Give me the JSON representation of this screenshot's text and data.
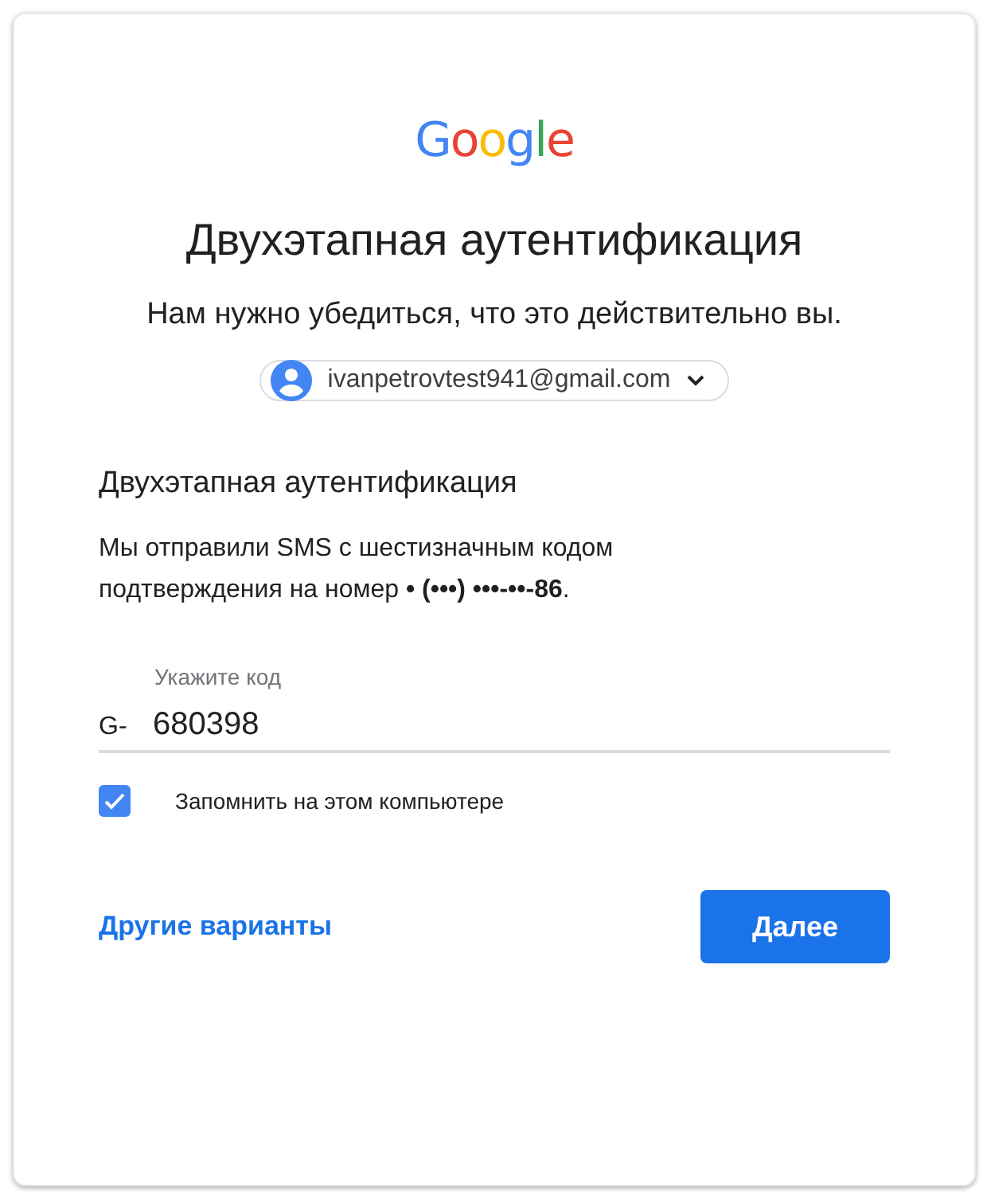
{
  "logo": {
    "letters": [
      {
        "char": "G",
        "color": "#4285f4"
      },
      {
        "char": "o",
        "color": "#ea4335"
      },
      {
        "char": "o",
        "color": "#fbbc05"
      },
      {
        "char": "g",
        "color": "#4285f4"
      },
      {
        "char": "l",
        "color": "#34a853"
      },
      {
        "char": "e",
        "color": "#ea4335"
      }
    ]
  },
  "title": "Двухэтапная аутентификация",
  "subtitle": "Нам нужно убедиться, что это действительно вы.",
  "account": {
    "email": "ivanpetrovtest941@gmail.com",
    "expanded": false
  },
  "section": {
    "heading": "Двухэтапная аутентификация",
    "message": "Мы отправили SMS с шестизначным кодом подтверждения на номер **• (•••) •••-••-86**."
  },
  "code_field": {
    "label": "Укажите код",
    "prefix": "G-",
    "value": "680398"
  },
  "remember": {
    "label": "Запомнить на этом компьютере",
    "checked": true
  },
  "other_options": "Другие варианты",
  "next_button": "Далее"
}
